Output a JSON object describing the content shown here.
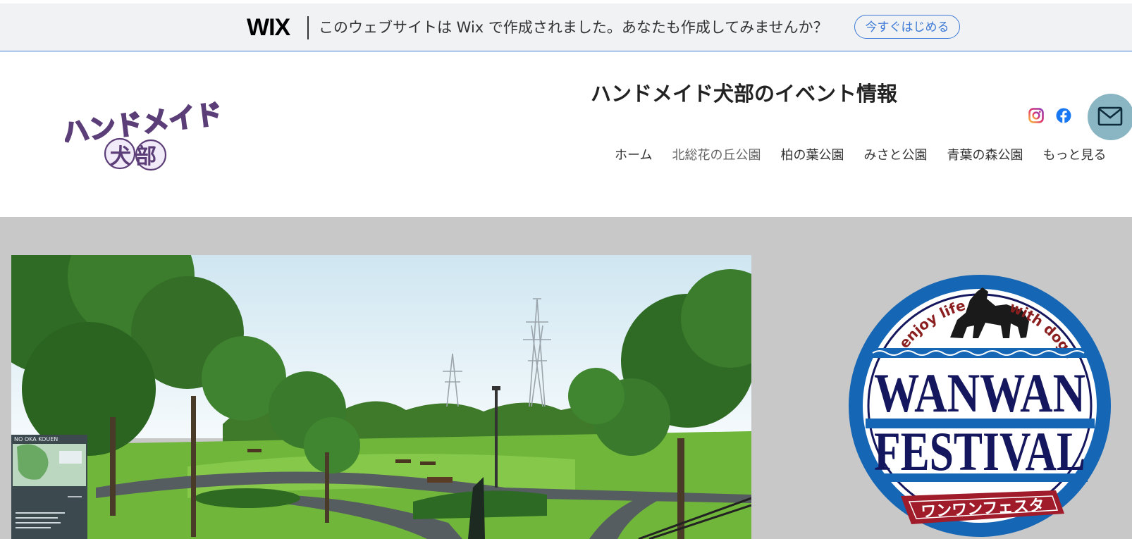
{
  "wix_banner": {
    "logo_text": "WIX",
    "message": "このウェブサイトは Wix で作成されました。あなたも作成してみませんか？",
    "start_button": "今すぐはじめる"
  },
  "header": {
    "logo": {
      "line1": "ハンドメイド",
      "line2": "犬部"
    },
    "site_title": "ハンドメイド犬部のイベント情報",
    "social": [
      {
        "icon": "instagram-icon"
      },
      {
        "icon": "facebook-icon"
      }
    ],
    "mail_icon": "mail-icon",
    "nav": [
      {
        "label": "ホーム"
      },
      {
        "label": "北総花の丘公園"
      },
      {
        "label": "柏の葉公園"
      },
      {
        "label": "みさと公園"
      },
      {
        "label": "青葉の森公園"
      },
      {
        "label": "もっと見る"
      }
    ]
  },
  "main": {
    "park_photo": {
      "sign_text": "NO OKA KOUEN"
    },
    "festival_logo": {
      "top_left": "enjoy life",
      "top_right": "with dogs",
      "line1": "WANWAN",
      "line2": "FESTIVAL",
      "ribbon": "ワンワンフェスタ"
    }
  },
  "colors": {
    "accent_blue": "#3d7bd6",
    "mail_button": "#8ab6c4",
    "main_background": "#c8c8c8",
    "festival_blue": "#1566b5",
    "festival_navy": "#15175e",
    "festival_red": "#a01c2a"
  }
}
